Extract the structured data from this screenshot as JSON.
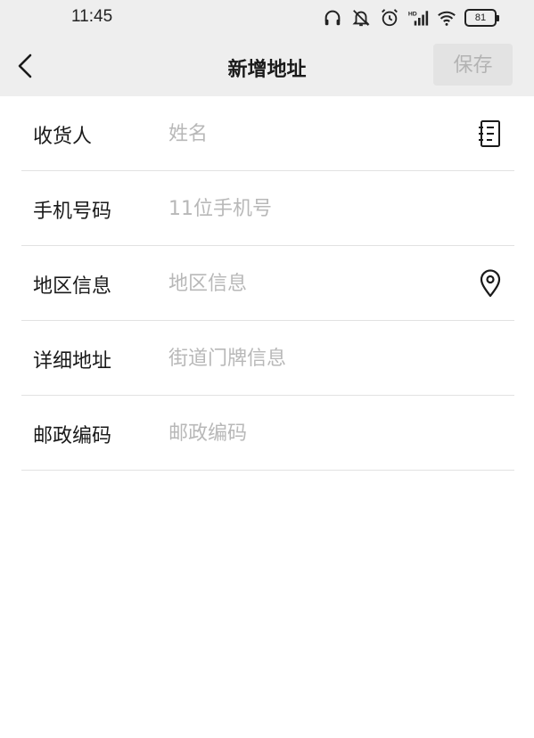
{
  "status_bar": {
    "time": "11:45",
    "battery_level": "81",
    "icons": [
      "headphones-icon",
      "bell-muted-icon",
      "alarm-icon",
      "hd-signal-icon",
      "wifi-icon",
      "battery-icon"
    ]
  },
  "nav": {
    "title": "新增地址",
    "back_icon": "chevron-left-icon",
    "save_label": "保存"
  },
  "form": {
    "fields": [
      {
        "label": "收货人",
        "placeholder": "姓名",
        "value": "",
        "icon": "contact-book-icon"
      },
      {
        "label": "手机号码",
        "placeholder": "11位手机号",
        "value": ""
      },
      {
        "label": "地区信息",
        "placeholder": "地区信息",
        "value": "",
        "icon": "location-pin-icon"
      },
      {
        "label": "详细地址",
        "placeholder": "街道门牌信息",
        "value": ""
      },
      {
        "label": "邮政编码",
        "placeholder": "邮政编码",
        "value": ""
      }
    ]
  },
  "colors": {
    "header_background": "#eeeeee",
    "placeholder": "#b8b8b8",
    "save_disabled_text": "#b3b3b3",
    "divider": "#e2e2e2"
  }
}
